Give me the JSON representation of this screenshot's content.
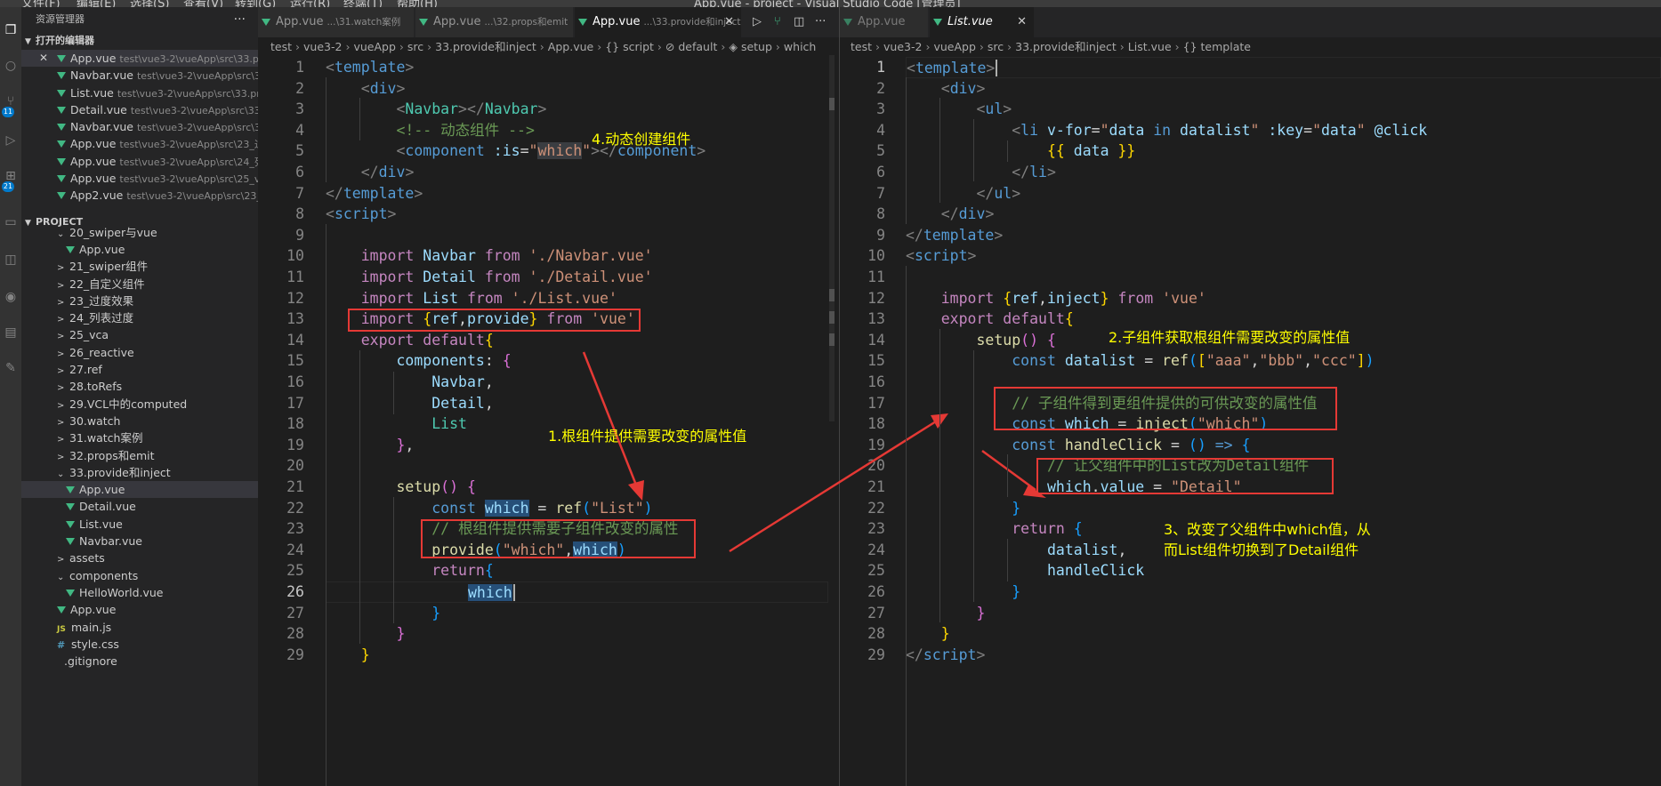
{
  "window": {
    "menu": [
      "文件(F)",
      "编辑(E)",
      "选择(S)",
      "查看(V)",
      "转到(G)",
      "运行(R)",
      "终端(T)",
      "帮助(H)"
    ],
    "title": "App.vue - project - Visual Studio Code [管理员]"
  },
  "activity": {
    "badge_scm": "11",
    "badge_ext": "21"
  },
  "sidebar": {
    "title": "资源管理器",
    "more": "···",
    "open_editors_label": "打开的编辑器",
    "open_editors": [
      {
        "name": "App.vue",
        "path": "test\\vue3-2\\vueApp\\src\\33.provid...",
        "close": "✕"
      },
      {
        "name": "Navbar.vue",
        "path": "test\\vue3-2\\vueApp\\src\\33.pro..."
      },
      {
        "name": "List.vue",
        "path": "test\\vue3-2\\vueApp\\src\\33.provide..."
      },
      {
        "name": "Detail.vue",
        "path": "test\\vue3-2\\vueApp\\src\\33.provi..."
      },
      {
        "name": "Navbar.vue",
        "path": "test\\vue3-2\\vueApp\\src\\32.pro..."
      },
      {
        "name": "App.vue",
        "path": "test\\vue3-2\\vueApp\\src\\23_过度..."
      },
      {
        "name": "App.vue",
        "path": "test\\vue3-2\\vueApp\\src\\24_列表..."
      },
      {
        "name": "App.vue",
        "path": "test\\vue3-2\\vueApp\\src\\25_vca"
      },
      {
        "name": "App2.vue",
        "path": "test\\vue3-2\\vueApp\\src\\23_过度..."
      }
    ],
    "project_label": "PROJECT",
    "tree": [
      {
        "label": "20_swiper与vue",
        "kind": "folder-open",
        "indent": 1
      },
      {
        "label": "App.vue",
        "kind": "vue",
        "indent": 2
      },
      {
        "label": "21_swiper组件",
        "kind": "folder",
        "indent": 1
      },
      {
        "label": "22_自定义组件",
        "kind": "folder",
        "indent": 1
      },
      {
        "label": "23_过度效果",
        "kind": "folder",
        "indent": 1
      },
      {
        "label": "24_列表过度",
        "kind": "folder",
        "indent": 1
      },
      {
        "label": "25_vca",
        "kind": "folder",
        "indent": 1
      },
      {
        "label": "26_reactive",
        "kind": "folder",
        "indent": 1
      },
      {
        "label": "27.ref",
        "kind": "folder",
        "indent": 1
      },
      {
        "label": "28.toRefs",
        "kind": "folder",
        "indent": 1
      },
      {
        "label": "29.VCL中的computed",
        "kind": "folder",
        "indent": 1
      },
      {
        "label": "30.watch",
        "kind": "folder",
        "indent": 1
      },
      {
        "label": "31.watch案例",
        "kind": "folder",
        "indent": 1
      },
      {
        "label": "32.props和emit",
        "kind": "folder",
        "indent": 1
      },
      {
        "label": "33.provide和inject",
        "kind": "folder-open",
        "indent": 1
      },
      {
        "label": "App.vue",
        "kind": "vue",
        "indent": 2,
        "selected": true
      },
      {
        "label": "Detail.vue",
        "kind": "vue",
        "indent": 2
      },
      {
        "label": "List.vue",
        "kind": "vue",
        "indent": 2
      },
      {
        "label": "Navbar.vue",
        "kind": "vue",
        "indent": 2
      },
      {
        "label": "assets",
        "kind": "folder",
        "indent": 1
      },
      {
        "label": "components",
        "kind": "folder-open",
        "indent": 1
      },
      {
        "label": "HelloWorld.vue",
        "kind": "vue",
        "indent": 2
      },
      {
        "label": "App.vue",
        "kind": "vue",
        "indent": 1
      },
      {
        "label": "main.js",
        "kind": "js",
        "indent": 1
      },
      {
        "label": "style.css",
        "kind": "css",
        "indent": 1
      },
      {
        "label": ".gitignore",
        "kind": "file",
        "indent": 0
      }
    ]
  },
  "left_editor": {
    "tabs": [
      {
        "name": "App.vue",
        "desc": "...\\31.watch案例"
      },
      {
        "name": "App.vue",
        "desc": "...\\32.props和emit"
      },
      {
        "name": "App.vue",
        "desc": "...\\33.provide和inject",
        "active": true,
        "close": "✕"
      }
    ],
    "actions": [
      "▷",
      "⑂",
      "◫",
      "···"
    ],
    "breadcrumb": [
      "test",
      "vue3-2",
      "vueApp",
      "src",
      "33.provide和inject",
      "App.vue",
      "{} script",
      "⊘ default",
      "◈ setup",
      "which"
    ]
  },
  "right_editor": {
    "tabs": [
      {
        "name": "App.vue",
        "desc": ""
      },
      {
        "name": "List.vue",
        "desc": "",
        "active": true,
        "close": "✕"
      }
    ],
    "breadcrumb": [
      "test",
      "vue3-2",
      "vueApp",
      "src",
      "33.provide和inject",
      "List.vue",
      "{} template"
    ]
  },
  "annotations": {
    "a1": "1.根组件提供需要改变的属性值",
    "a2": "2.子组件获取根组件需要改变的属性值",
    "a3_line1": "3、改变了父组件中which值，从",
    "a3_line2": "而List组件切换到了Detail组件",
    "a4": "4.动态创建组件"
  },
  "colors": {
    "annotation": "#ffff00",
    "box": "#e53935",
    "accent": "#007acc"
  }
}
